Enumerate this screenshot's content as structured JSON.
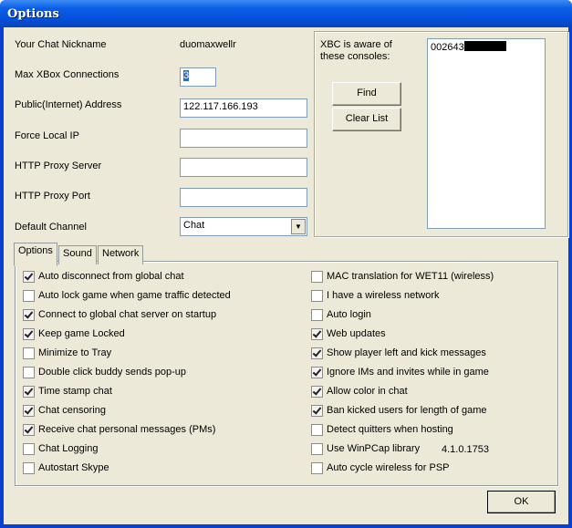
{
  "window": {
    "title": "Options"
  },
  "form": {
    "nickname_label": "Your Chat Nickname",
    "nickname_value": "duomaxwellr",
    "max_conn_label": "Max XBox Connections",
    "max_conn_value": "3",
    "public_addr_label": "Public(Internet) Address",
    "public_addr_value": "122.117.166.193",
    "force_ip_label": "Force Local IP",
    "force_ip_value": "",
    "proxy_server_label": "HTTP Proxy Server",
    "proxy_server_value": "",
    "proxy_port_label": "HTTP Proxy Port",
    "proxy_port_value": "",
    "channel_label": "Default Channel",
    "channel_value": "Chat"
  },
  "consoles": {
    "label": "XBC is aware of these consoles:",
    "items": [
      "002643"
    ],
    "find_label": "Find",
    "clear_label": "Clear List"
  },
  "tabs": [
    {
      "label": "Options",
      "active": true
    },
    {
      "label": "Sound"
    },
    {
      "label": "Network"
    }
  ],
  "left_options": [
    {
      "label": "Auto disconnect from global chat",
      "checked": true
    },
    {
      "label": "Auto lock game when game traffic detected",
      "checked": false
    },
    {
      "label": "Connect to global chat server on startup",
      "checked": true
    },
    {
      "label": "Keep game Locked",
      "checked": true
    },
    {
      "label": "Minimize to Tray",
      "checked": false
    },
    {
      "label": "Double click buddy sends pop-up",
      "checked": false
    },
    {
      "label": "Time stamp chat",
      "checked": true
    },
    {
      "label": "Chat censoring",
      "checked": true
    },
    {
      "label": "Receive chat personal messages (PMs)",
      "checked": true
    },
    {
      "label": "Chat Logging",
      "checked": false
    },
    {
      "label": "Autostart Skype",
      "checked": false
    }
  ],
  "right_options": [
    {
      "label": "MAC translation for WET11 (wireless)",
      "checked": false
    },
    {
      "label": "I have a wireless network",
      "checked": false
    },
    {
      "label": "Auto login",
      "checked": false
    },
    {
      "label": "Web updates",
      "checked": true
    },
    {
      "label": "Show player left and kick messages",
      "checked": true
    },
    {
      "label": "Ignore IMs and invites while in game",
      "checked": true
    },
    {
      "label": "Allow color in chat",
      "checked": true
    },
    {
      "label": "Ban kicked users for length of game",
      "checked": true
    },
    {
      "label": "Detect quitters when hosting",
      "checked": false
    },
    {
      "label": "Use WinPCap library",
      "checked": false
    },
    {
      "label": "Auto cycle wireless for PSP",
      "checked": false
    }
  ],
  "version": "4.1.0.1753",
  "ok_label": "OK"
}
